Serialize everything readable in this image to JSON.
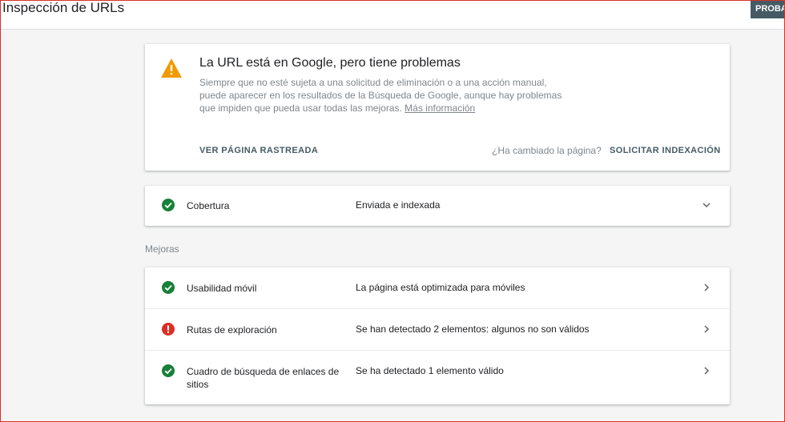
{
  "header": {
    "title": "Inspección de URLs",
    "badge": "PROBAR"
  },
  "alert": {
    "title": "La URL está en Google, pero tiene problemas",
    "description": "Siempre que no esté sujeta a una solicitud de eliminación o a una acción manual, puede aparecer en los resultados de la Búsqueda de Google, aunque hay problemas que impiden que pueda usar todas las mejoras.",
    "more_info_link": "Más información",
    "view_crawled_label": "VER PÁGINA RASTREADA",
    "changed_question": "¿Ha cambiado la página?",
    "request_indexing_label": "SOLICITAR INDEXACIÓN",
    "icon": "warning-icon",
    "icon_color": "#f29900"
  },
  "coverage": {
    "label": "Cobertura",
    "value": "Enviada e indexada",
    "status": "valid",
    "icon": "check-circle-icon"
  },
  "enhancements": {
    "section_label": "Mejoras",
    "items": [
      {
        "label": "Usabilidad móvil",
        "value": "La página está optimizada para móviles",
        "status": "valid",
        "icon": "check-circle-icon"
      },
      {
        "label": "Rutas de exploración",
        "value": "Se han detectado 2 elementos: algunos no son válidos",
        "status": "error",
        "icon": "error-circle-icon"
      },
      {
        "label": "Cuadro de búsqueda de enlaces de sitios",
        "value": "Se ha detectado 1 elemento válido",
        "status": "valid",
        "icon": "check-circle-icon"
      }
    ]
  },
  "colors": {
    "valid": "#188038",
    "error": "#d93025",
    "warning": "#f29900",
    "action": "#455a64"
  }
}
